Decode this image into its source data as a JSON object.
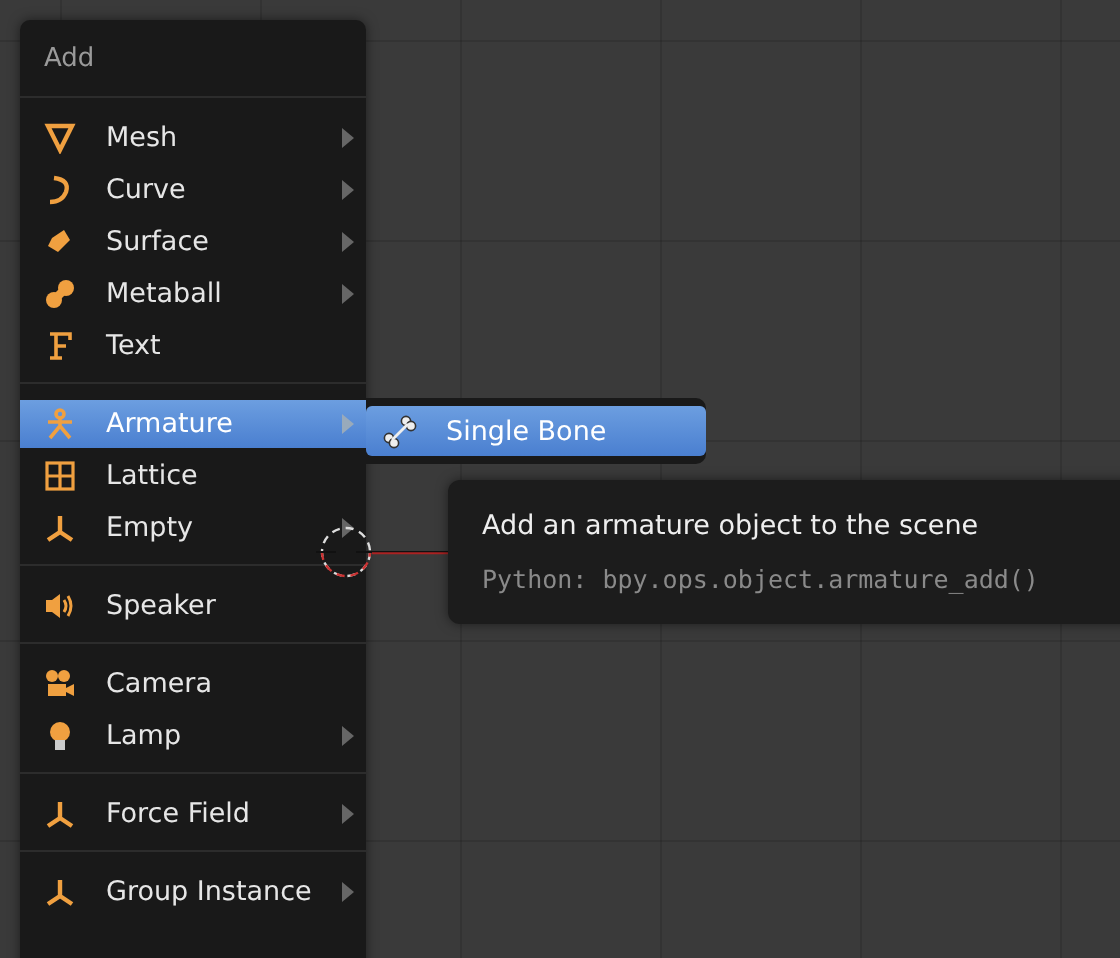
{
  "menu": {
    "title": "Add",
    "groups": [
      [
        {
          "label": "Mesh",
          "submenu": true,
          "selected": false
        },
        {
          "label": "Curve",
          "submenu": true,
          "selected": false
        },
        {
          "label": "Surface",
          "submenu": true,
          "selected": false
        },
        {
          "label": "Metaball",
          "submenu": true,
          "selected": false
        },
        {
          "label": "Text",
          "submenu": false,
          "selected": false
        }
      ],
      [
        {
          "label": "Armature",
          "submenu": true,
          "selected": true
        },
        {
          "label": "Lattice",
          "submenu": false,
          "selected": false
        },
        {
          "label": "Empty",
          "submenu": true,
          "selected": false
        }
      ],
      [
        {
          "label": "Speaker",
          "submenu": false,
          "selected": false
        }
      ],
      [
        {
          "label": "Camera",
          "submenu": false,
          "selected": false
        },
        {
          "label": "Lamp",
          "submenu": true,
          "selected": false
        }
      ],
      [
        {
          "label": "Force Field",
          "submenu": true,
          "selected": false
        }
      ],
      [
        {
          "label": "Group Instance",
          "submenu": true,
          "selected": false
        }
      ]
    ]
  },
  "submenu": {
    "items": [
      {
        "label": "Single Bone",
        "selected": true
      }
    ]
  },
  "tooltip": {
    "description": "Add an armature object to the scene",
    "python": "Python: bpy.ops.object.armature_add()"
  }
}
